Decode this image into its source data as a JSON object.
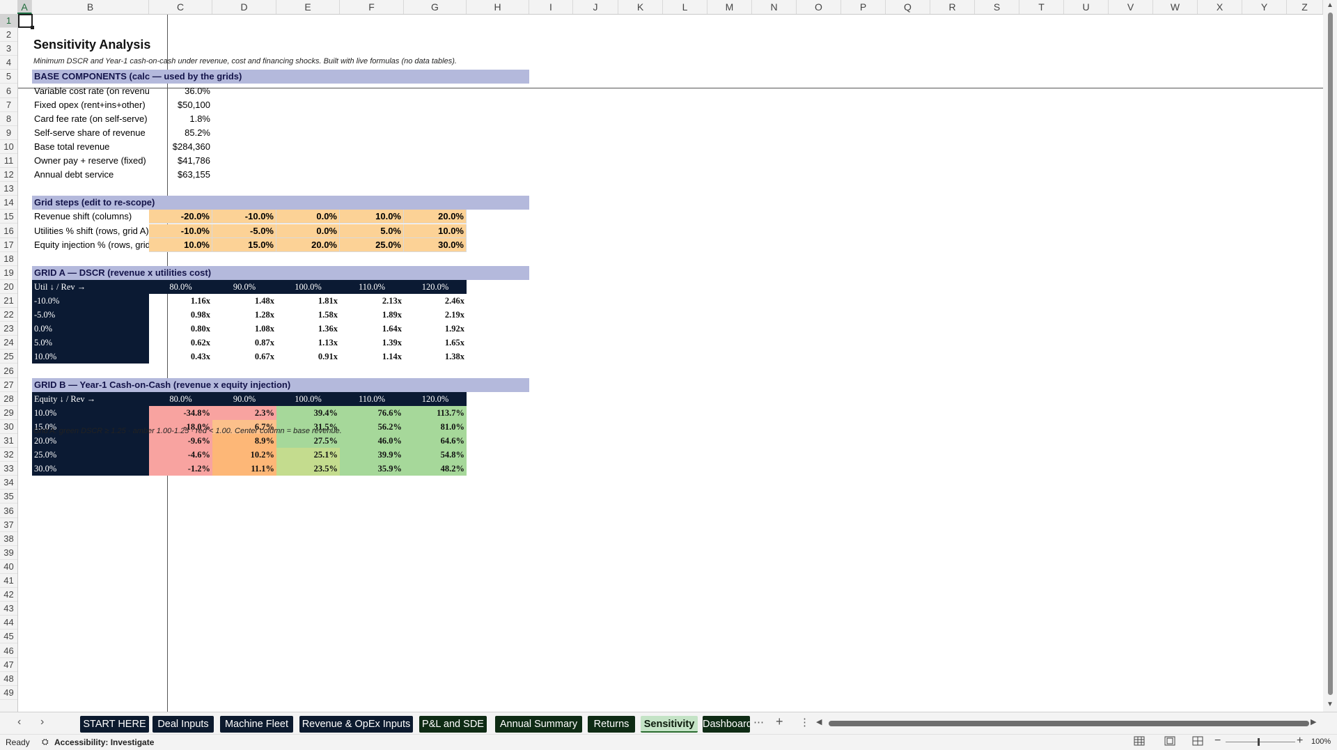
{
  "columns": [
    "A",
    "B",
    "C",
    "D",
    "E",
    "F",
    "G",
    "H",
    "I",
    "J",
    "K",
    "L",
    "M",
    "N",
    "O",
    "P",
    "Q",
    "R",
    "S",
    "T",
    "U",
    "V",
    "W",
    "X",
    "Y",
    "Z"
  ],
  "rows": [
    "1",
    "2",
    "3",
    "4",
    "5",
    "6",
    "7",
    "8",
    "9",
    "10",
    "11",
    "12",
    "13",
    "14",
    "15",
    "16",
    "17",
    "18",
    "19",
    "20",
    "21",
    "22",
    "23",
    "24",
    "25",
    "26",
    "27",
    "28",
    "29",
    "30",
    "31",
    "32",
    "33",
    "34",
    "35",
    "36",
    "37",
    "38",
    "39",
    "40",
    "41",
    "42",
    "43",
    "44",
    "45",
    "46",
    "47",
    "48",
    "49"
  ],
  "sheet": {
    "title": "Sensitivity Analysis",
    "subtitle": "Minimum DSCR and Year-1 cash-on-cash under revenue, cost and financing shocks. Built with live formulas (no data tables).",
    "base_header": "BASE COMPONENTS (calc — used by the grids)",
    "base_items": [
      {
        "label": "Variable cost rate (on revenue)",
        "value": "36.0%"
      },
      {
        "label": "Fixed opex (rent+ins+other)",
        "value": "$50,100"
      },
      {
        "label": "Card fee rate (on self-serve)",
        "value": "1.8%"
      },
      {
        "label": "Self-serve share of revenue",
        "value": "85.2%"
      },
      {
        "label": "Base total revenue",
        "value": "$284,360"
      },
      {
        "label": "Owner pay + reserve (fixed)",
        "value": "$41,786"
      },
      {
        "label": "Annual debt service",
        "value": "$63,155"
      }
    ],
    "steps_header": "Grid steps (edit to re-scope)",
    "steps": [
      {
        "label": "Revenue shift (columns)",
        "values": [
          "-20.0%",
          "-10.0%",
          "0.0%",
          "10.0%",
          "20.0%"
        ]
      },
      {
        "label": "Utilities % shift (rows, grid A)",
        "values": [
          "-10.0%",
          "-5.0%",
          "0.0%",
          "5.0%",
          "10.0%"
        ]
      },
      {
        "label": "Equity injection % (rows, grid B)",
        "values": [
          "10.0%",
          "15.0%",
          "20.0%",
          "25.0%",
          "30.0%"
        ]
      }
    ],
    "grid_a": {
      "header": "GRID A — DSCR (revenue x utilities cost)",
      "corner": "Util ↓ / Rev →",
      "cols": [
        "80.0%",
        "90.0%",
        "100.0%",
        "110.0%",
        "120.0%"
      ],
      "rows": [
        {
          "label": "-10.0%",
          "values": [
            "1.16x",
            "1.48x",
            "1.81x",
            "2.13x",
            "2.46x"
          ]
        },
        {
          "label": "-5.0%",
          "values": [
            "0.98x",
            "1.28x",
            "1.58x",
            "1.89x",
            "2.19x"
          ]
        },
        {
          "label": "0.0%",
          "values": [
            "0.80x",
            "1.08x",
            "1.36x",
            "1.64x",
            "1.92x"
          ]
        },
        {
          "label": "5.0%",
          "values": [
            "0.62x",
            "0.87x",
            "1.13x",
            "1.39x",
            "1.65x"
          ]
        },
        {
          "label": "10.0%",
          "values": [
            "0.43x",
            "0.67x",
            "0.91x",
            "1.14x",
            "1.38x"
          ]
        }
      ]
    },
    "grid_b": {
      "header": "GRID B — Year-1 Cash-on-Cash (revenue x equity injection)",
      "corner": "Equity ↓ / Rev →",
      "cols": [
        "80.0%",
        "90.0%",
        "100.0%",
        "110.0%",
        "120.0%"
      ],
      "rows": [
        {
          "label": "10.0%",
          "values": [
            "-34.8%",
            "2.3%",
            "39.4%",
            "76.6%",
            "113.7%"
          ],
          "colors": [
            "#f8a3a0",
            "#f8a3a0",
            "#a6d89a",
            "#a6d89a",
            "#a6d89a"
          ]
        },
        {
          "label": "15.0%",
          "values": [
            "-18.0%",
            "6.7%",
            "31.5%",
            "56.2%",
            "81.0%"
          ],
          "colors": [
            "#f8a3a0",
            "#fcc08b",
            "#a6d89a",
            "#a6d89a",
            "#a6d89a"
          ]
        },
        {
          "label": "20.0%",
          "values": [
            "-9.6%",
            "8.9%",
            "27.5%",
            "46.0%",
            "64.6%"
          ],
          "colors": [
            "#f8a3a0",
            "#fdb777",
            "#a6d89a",
            "#a6d89a",
            "#a6d89a"
          ]
        },
        {
          "label": "25.0%",
          "values": [
            "-4.6%",
            "10.2%",
            "25.1%",
            "39.9%",
            "54.8%"
          ],
          "colors": [
            "#f8a3a0",
            "#fdb777",
            "#c4dc8e",
            "#a6d89a",
            "#a6d89a"
          ]
        },
        {
          "label": "30.0%",
          "values": [
            "-1.2%",
            "11.1%",
            "23.5%",
            "35.9%",
            "48.2%"
          ],
          "colors": [
            "#f8a3a0",
            "#fdb777",
            "#c4dc8e",
            "#a6d89a",
            "#a6d89a"
          ]
        }
      ]
    },
    "footnote": "Grid A: green DSCR ≥ 1.25 · amber 1.00-1.25 · red < 1.00. Center column = base revenue."
  },
  "tabs": {
    "items": [
      {
        "label": "START HERE",
        "style": "navy"
      },
      {
        "label": "Deal Inputs",
        "style": "navy"
      },
      {
        "label": "Machine Fleet",
        "style": "navy"
      },
      {
        "label": "Revenue & OpEx Inputs",
        "style": "navy"
      },
      {
        "label": "P&L and SDE",
        "style": "green"
      },
      {
        "label": "Annual Summary",
        "style": "green"
      },
      {
        "label": "Returns",
        "style": "green"
      },
      {
        "label": "Sensitivity",
        "style": "active"
      },
      {
        "label": "Dashboard",
        "style": "green"
      }
    ],
    "more": "⋯",
    "add": "+",
    "options": "⋮"
  },
  "status": {
    "ready": "Ready",
    "accessibility": "Accessibility: Investigate",
    "zoom": "100%"
  }
}
